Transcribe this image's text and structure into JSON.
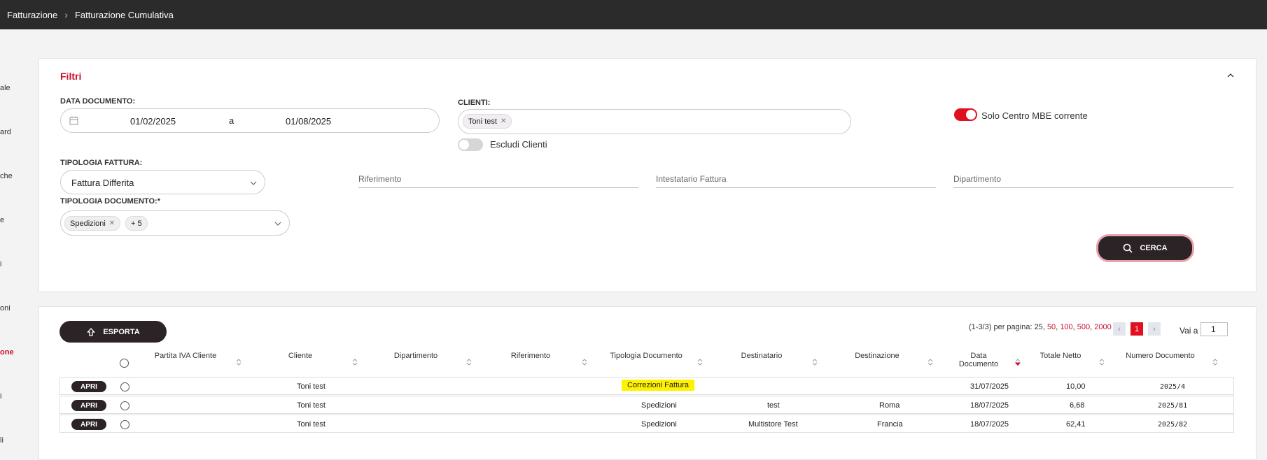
{
  "breadcrumb": {
    "item1": "Fatturazione",
    "item2": "Fatturazione Cumulativa"
  },
  "sidebar_fragments": [
    "ale",
    "ard",
    "che",
    "e",
    "i",
    "oni",
    "one",
    "i",
    "li"
  ],
  "filters": {
    "title": "Filtri",
    "data_documento_label": "DATA DOCUMENTO:",
    "date_from": "01/02/2025",
    "date_sep": "a",
    "date_to": "01/08/2025",
    "clienti_label": "CLIENTI:",
    "client_chip": "Toni test",
    "escludi_clienti": "Escludi Clienti",
    "solo_centro": "Solo Centro MBE corrente",
    "tipologia_fattura_label": "TIPOLOGIA FATTURA:",
    "tipologia_fattura_value": "Fattura Differita",
    "riferimento_placeholder": "Riferimento",
    "intestatario_placeholder": "Intestatario Fattura",
    "dipartimento_placeholder": "Dipartimento",
    "tipologia_documento_label": "TIPOLOGIA DOCUMENTO:*",
    "doc_chip": "Spedizioni",
    "doc_more": "+ 5",
    "cerca": "CERCA"
  },
  "results": {
    "esporta": "ESPORTA",
    "pager_count": "(1-3/3) per pagina:",
    "page_sizes": [
      "25",
      "50",
      "100",
      "500",
      "2000"
    ],
    "current_page": "1",
    "vai_a": "Vai a",
    "vai_value": "1",
    "columns": [
      "Partita IVA Cliente",
      "Cliente",
      "Dipartimento",
      "Riferimento",
      "Tipologia Documento",
      "Destinatario",
      "Destinazione",
      "Data Documento",
      "Totale Netto",
      "Numero Documento"
    ],
    "apri": "APRI",
    "rows": [
      {
        "cliente": "Toni test",
        "tipologia": "Correzioni Fattura",
        "destinatario": "",
        "destinazione": "",
        "data": "31/07/2025",
        "totale": "10,00",
        "numero": "2025/4"
      },
      {
        "cliente": "Toni test",
        "tipologia": "Spedizioni",
        "destinatario": "test",
        "destinazione": "Roma",
        "data": "18/07/2025",
        "totale": "6,68",
        "numero": "2025/81"
      },
      {
        "cliente": "Toni test",
        "tipologia": "Spedizioni",
        "destinatario": "Multistore Test",
        "destinazione": "Francia",
        "data": "18/07/2025",
        "totale": "62,41",
        "numero": "2025/82"
      }
    ]
  },
  "colors": {
    "accent": "#c8102e",
    "dark": "#2b2326",
    "highlight": "#fff200"
  }
}
